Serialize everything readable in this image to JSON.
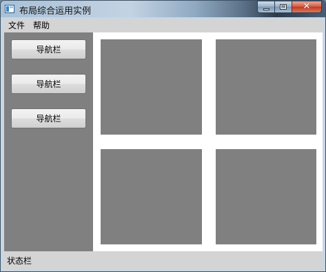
{
  "window": {
    "title": "布局综合运用实例",
    "icon": "app-window-icon",
    "controls": [
      "minimize-icon",
      "maximize-icon",
      "close-icon"
    ]
  },
  "menubar": {
    "items": [
      {
        "label": "文件"
      },
      {
        "label": "帮助"
      }
    ]
  },
  "sidebar": {
    "buttons": [
      {
        "label": "导航栏"
      },
      {
        "label": "导航栏"
      },
      {
        "label": "导航栏"
      }
    ]
  },
  "statusbar": {
    "text": "状态栏"
  },
  "colors": {
    "panel": "#808080",
    "content_bg": "#ffffff",
    "chrome": "#d4d4d4"
  }
}
